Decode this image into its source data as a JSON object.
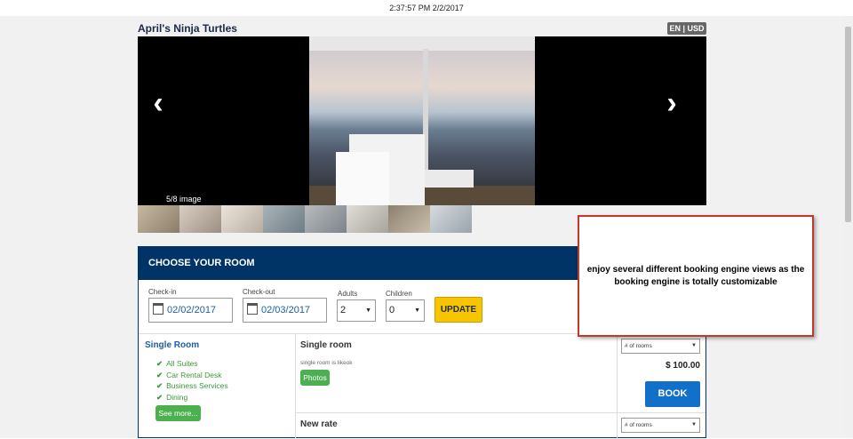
{
  "clock": "2:37:57 PM 2/2/2017",
  "hotel": {
    "name": "April's Ninja Turtles",
    "lang_currency": "EN | USD"
  },
  "gallery": {
    "counter": "5/8 image",
    "prev_glyph": "‹",
    "next_glyph": "›"
  },
  "booking": {
    "header": "CHOOSE YOUR ROOM",
    "checkin_label": "Check-in",
    "checkin_value": "02/02/2017",
    "checkout_label": "Check-out",
    "checkout_value": "02/03/2017",
    "adults_label": "Adults",
    "adults_value": "2",
    "children_label": "Children",
    "children_value": "0",
    "update_label": "UPDATE"
  },
  "room": {
    "title": "Single Room",
    "amenities": [
      "All Suites",
      "Car Rental Desk",
      "Business Services",
      "Dining"
    ],
    "see_more": "See more..."
  },
  "rates": [
    {
      "name": "Single room",
      "desc": "single room is likeok",
      "photos_label": "Photos",
      "rooms_placeholder": "# of rooms",
      "price": "$ 100.00",
      "book_label": "BOOK"
    },
    {
      "name": "New rate",
      "rooms_placeholder": "# of rooms"
    }
  ],
  "callout": {
    "text": "enjoy several different booking engine views as the booking engine is totally customizable"
  },
  "colors": {
    "header_blue": "#003366",
    "update_yellow": "#f7c400",
    "book_blue": "#1270c8",
    "green": "#4caf50",
    "callout_border": "#c0392b"
  }
}
